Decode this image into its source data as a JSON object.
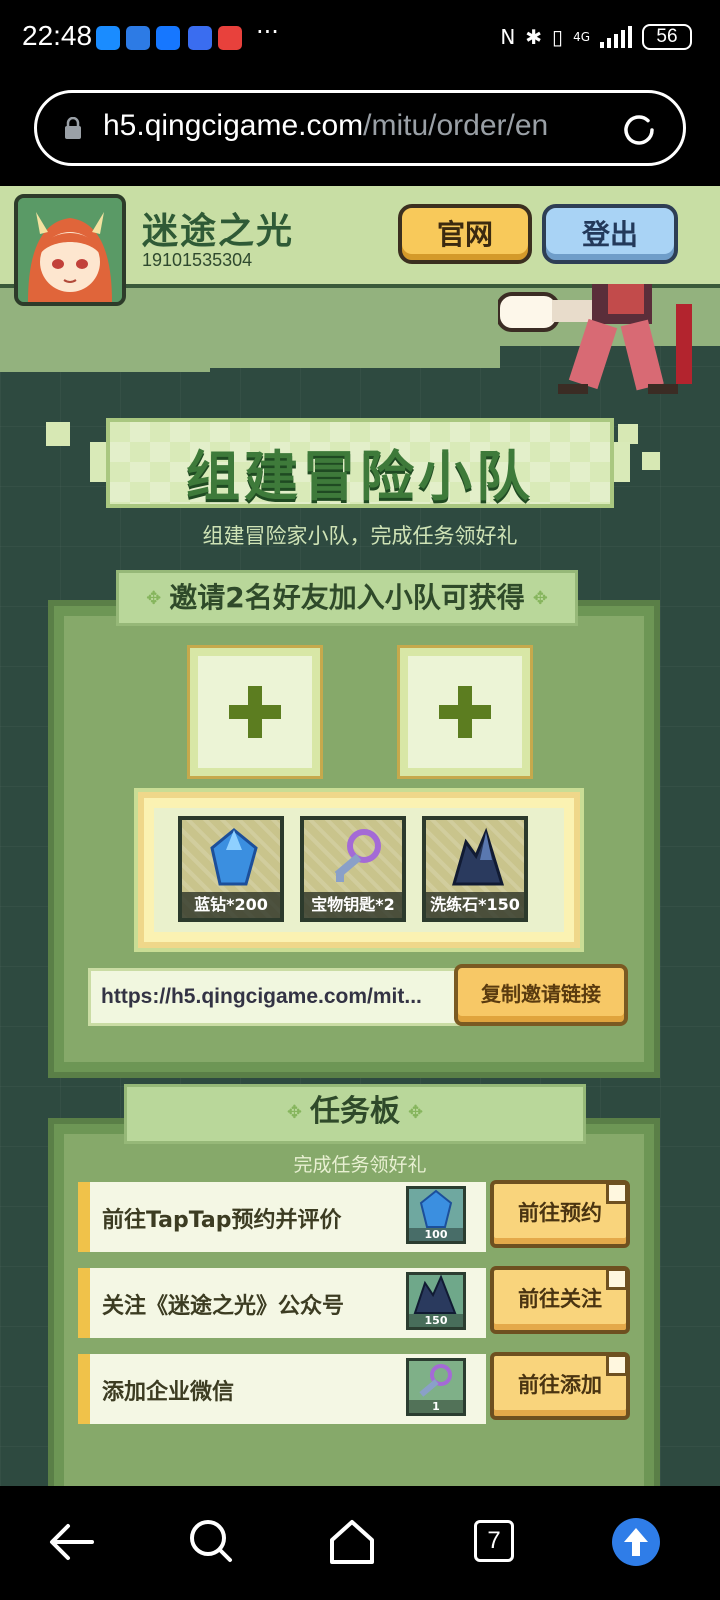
{
  "status_bar": {
    "time": "22:48",
    "overflow_dots": "···",
    "network": "4G",
    "battery": "56"
  },
  "browser": {
    "url_host": "h5.qingcigame.com",
    "url_path": "/mitu/order/en"
  },
  "header": {
    "game_name": "迷途之光",
    "user_id": "19101535304",
    "official_button": "官网",
    "logout_button": "登出"
  },
  "hero": {
    "title": "组建冒险小队",
    "subtitle": "组建冒险家小队，完成任务领好礼"
  },
  "invite": {
    "ribbon": "邀请2名好友加入小队可获得",
    "rewards": [
      {
        "label": "蓝钻*200",
        "icon": "blue-diamond-icon"
      },
      {
        "label": "宝物钥匙*2",
        "icon": "treasure-key-icon"
      },
      {
        "label": "洗练石*150",
        "icon": "refining-stone-icon"
      }
    ],
    "link": "https://h5.qingcigame.com/mit...",
    "copy_button": "复制邀请链接"
  },
  "tasks": {
    "title": "任务板",
    "subtitle": "完成任务领好礼",
    "items": [
      {
        "label": "前往TapTap预约并评价",
        "qty": "100",
        "icon": "blue-diamond-icon",
        "button": "前往预约"
      },
      {
        "label": "关注《迷途之光》公众号",
        "qty": "150",
        "icon": "refining-stone-icon",
        "button": "前往关注"
      },
      {
        "label": "添加企业微信",
        "qty": "1",
        "icon": "treasure-key-icon",
        "button": "前往添加"
      }
    ]
  },
  "nav": {
    "tab_count": "7"
  },
  "colors": {
    "page_bg": "#2e4a40",
    "header_bg": "#c8dea4",
    "panel_green": "#6d9655",
    "button_yellow": "#f7c866",
    "logout_blue": "#a9d3f5"
  }
}
